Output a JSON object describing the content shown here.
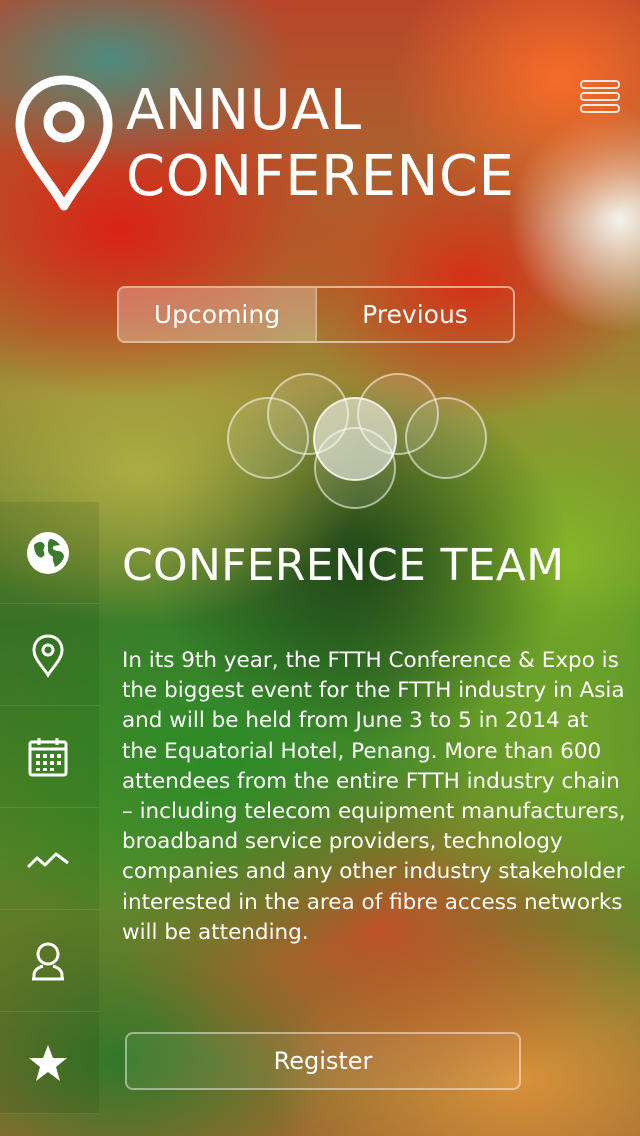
{
  "header": {
    "title_line1": "ANNUAL",
    "title_line2": "CONFERENCE",
    "logo_icon": "map-pin-icon",
    "menu_icon": "hamburger-menu-icon"
  },
  "tabs": [
    {
      "label": "Upcoming",
      "active": true
    },
    {
      "label": "Previous",
      "active": false
    }
  ],
  "sidebar": {
    "items": [
      {
        "icon": "globe-icon"
      },
      {
        "icon": "location-pin-icon"
      },
      {
        "icon": "calendar-icon"
      },
      {
        "icon": "trend-chart-icon"
      },
      {
        "icon": "user-icon"
      },
      {
        "icon": "star-icon"
      }
    ]
  },
  "content": {
    "section_title": "CONFERENCE TEAM",
    "description": "In its 9th year, the FTTH Conference & Expo is the biggest event for the FTTH industry in Asia and will be held from June 3 to 5 in 2014 at the Equatorial Hotel, Penang. More than 600 attendees from the entire FTTH industry chain – including telecom equipment manufacturers, broadband service providers, technology companies and any other industry stakeholder interested in the area of fibre access networks will be attending.",
    "register_label": "Register"
  },
  "colors": {
    "text": "#ffffff",
    "active_tab_bg": "rgba(255,255,255,0.28)"
  }
}
